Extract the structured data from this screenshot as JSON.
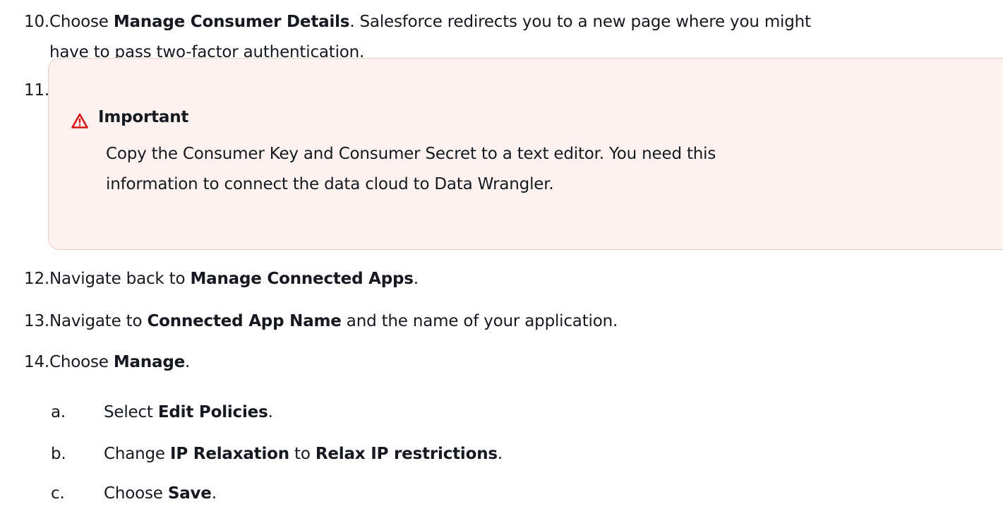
{
  "steps": [
    {
      "number": "10.",
      "lines": [
        {
          "pre": "Choose ",
          "bold": "Manage Consumer Details",
          "post": ". Salesforce redirects you to a new page where you might"
        },
        {
          "pre": "have to pass two-factor authentication.",
          "bold": "",
          "post": ""
        }
      ]
    },
    {
      "number": "11.",
      "callout": {
        "icon": "warning-triangle-icon",
        "title": "Important",
        "lines": [
          "Copy the Consumer Key and Consumer Secret to a text editor. You need this",
          "information to connect the data cloud to Data Wrangler."
        ],
        "colors": {
          "background": "#fdf2f0",
          "border": "#f4cfc9",
          "icon": "#d91515"
        }
      }
    },
    {
      "number": "12.",
      "pre": "Navigate back to ",
      "bold": "Manage Connected Apps",
      "post": "."
    },
    {
      "number": "13.",
      "pre": "Navigate to ",
      "bold": "Connected App Name",
      "post": " and the name of your application."
    },
    {
      "number": "14.",
      "pre": "Choose ",
      "bold": "Manage",
      "post": "."
    }
  ],
  "substeps": [
    {
      "letter": "a.",
      "pre": "Select ",
      "bold": "Edit Policies",
      "mid": ".",
      "bold2": "",
      "post": ""
    },
    {
      "letter": "b.",
      "pre": "Change ",
      "bold": "IP Relaxation",
      "mid": " to ",
      "bold2": "Relax IP restrictions",
      "post": "."
    },
    {
      "letter": "c.",
      "pre": "Choose ",
      "bold": "Save",
      "mid": ".",
      "bold2": "",
      "post": ""
    }
  ]
}
